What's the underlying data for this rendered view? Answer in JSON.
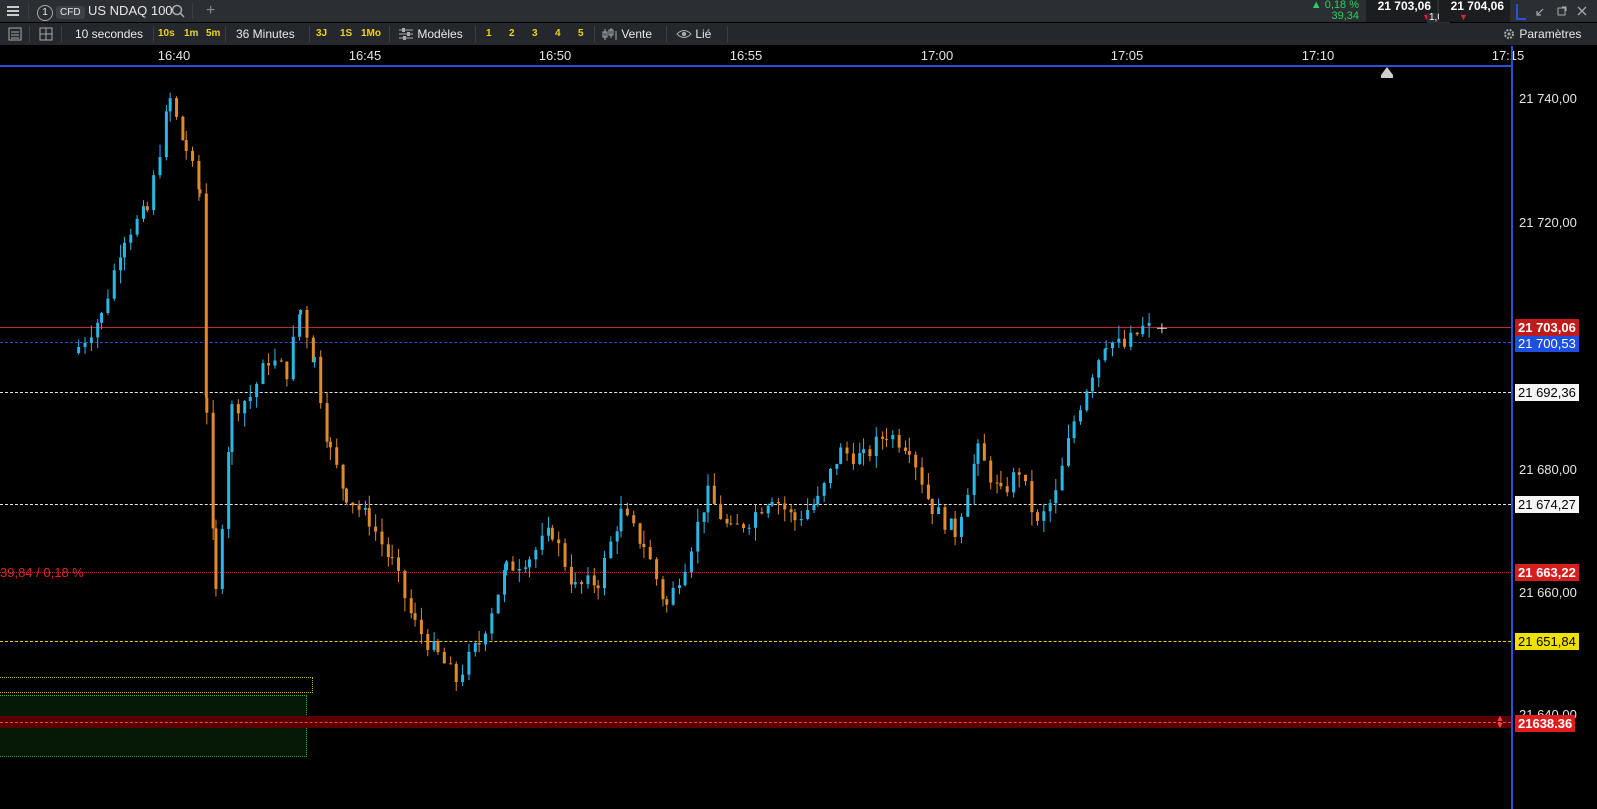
{
  "header": {
    "menu_icon": "hamburger-icon",
    "tab_number": "1",
    "product_type": "CFD",
    "instrument": "US NDAQ 100",
    "search_icon": "search-icon",
    "add_tab": "+",
    "change_pct": "0,18 %",
    "change_abs": "39,34",
    "bid": "21 703,06",
    "ask": "21 704,06",
    "spread": "1,00",
    "colors": {
      "up": "#29d35a",
      "down": "#e0252a",
      "accent": "#2b50d8"
    }
  },
  "toolbar": {
    "interval_label": "10 secondes",
    "intervals": [
      "10s",
      "1m",
      "5m"
    ],
    "range_label": "36 Minutes",
    "ranges": [
      "3J",
      "1S",
      "1Mo"
    ],
    "templates_label": "Modèles",
    "layouts": [
      "1",
      "2",
      "3",
      "4",
      "5"
    ],
    "side_label": "Vente",
    "link_label": "Lié",
    "settings_label": "Paramètres"
  },
  "time_axis": [
    "16:40",
    "16:45",
    "16:50",
    "16:55",
    "17:00",
    "17:05",
    "17:10",
    "17:15"
  ],
  "price_axis": [
    "21 740,00",
    "21 720,00",
    "21 680,00",
    "21 660,00",
    "21 640,00"
  ],
  "levels": {
    "current": "21 703,06",
    "blue": "21 700,53",
    "white1": "21 692,36",
    "white2": "21 674,27",
    "red_dotted": "21 663,22",
    "yellow": "21 651,84",
    "order": "21638.36",
    "change_note": "39,84 / 0,18 %"
  },
  "chart_data": {
    "type": "candlestick",
    "title": "",
    "xlabel": "",
    "ylabel": "",
    "ylim": [
      21625,
      21752
    ],
    "x_ticks": [
      "16:40",
      "16:45",
      "16:50",
      "16:55",
      "17:00",
      "17:05",
      "17:10",
      "17:15"
    ],
    "up_color": "#2bb7e6",
    "down_color": "#e08a2e",
    "anchors": [
      [
        16.625,
        21700
      ],
      [
        16.635,
        21705
      ],
      [
        16.645,
        21718
      ],
      [
        16.655,
        21722
      ],
      [
        16.665,
        21740
      ],
      [
        16.672,
        21732
      ],
      [
        16.678,
        21725
      ],
      [
        16.681,
        21690
      ],
      [
        16.685,
        21660
      ],
      [
        16.692,
        21690
      ],
      [
        16.7,
        21692
      ],
      [
        16.708,
        21698
      ],
      [
        16.716,
        21696
      ],
      [
        16.722,
        21706
      ],
      [
        16.728,
        21698
      ],
      [
        16.735,
        21683
      ],
      [
        16.742,
        21676
      ],
      [
        16.752,
        21672
      ],
      [
        16.762,
        21665
      ],
      [
        16.772,
        21655
      ],
      [
        16.782,
        21650
      ],
      [
        16.79,
        21646
      ],
      [
        16.8,
        21652
      ],
      [
        16.812,
        21664
      ],
      [
        16.822,
        21666
      ],
      [
        16.832,
        21670
      ],
      [
        16.842,
        21661
      ],
      [
        16.852,
        21662
      ],
      [
        16.862,
        21673
      ],
      [
        16.872,
        21668
      ],
      [
        16.882,
        21658
      ],
      [
        16.89,
        21665
      ],
      [
        16.9,
        21676
      ],
      [
        16.91,
        21670
      ],
      [
        16.918,
        21672
      ],
      [
        16.928,
        21676
      ],
      [
        16.938,
        21672
      ],
      [
        16.948,
        21675
      ],
      [
        16.958,
        21683
      ],
      [
        16.968,
        21682
      ],
      [
        16.978,
        21686
      ],
      [
        16.988,
        21684
      ],
      [
        16.998,
        21674
      ],
      [
        17.008,
        21670
      ],
      [
        17.018,
        21683
      ],
      [
        17.028,
        21676
      ],
      [
        17.036,
        21680
      ],
      [
        17.044,
        21671
      ],
      [
        17.052,
        21676
      ],
      [
        17.06,
        21688
      ],
      [
        17.068,
        21696
      ],
      [
        17.074,
        21701
      ],
      [
        17.082,
        21700
      ],
      [
        17.09,
        21703
      ],
      [
        17.094,
        21703
      ]
    ]
  }
}
